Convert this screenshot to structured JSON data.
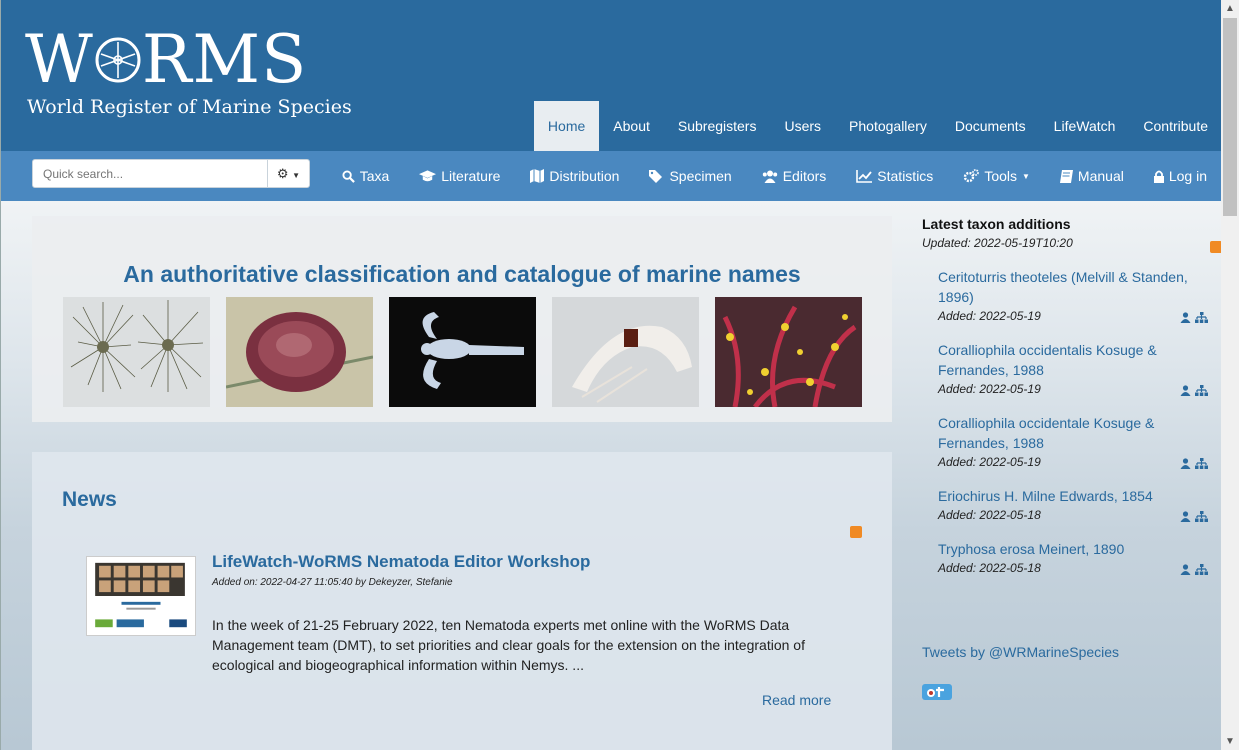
{
  "header": {
    "logo_text": "WoRMS",
    "logo_subtitle": "World Register of Marine Species"
  },
  "main_nav": [
    {
      "label": "Home",
      "active": true
    },
    {
      "label": "About"
    },
    {
      "label": "Subregisters"
    },
    {
      "label": "Users"
    },
    {
      "label": "Photogallery"
    },
    {
      "label": "Documents"
    },
    {
      "label": "LifeWatch"
    },
    {
      "label": "Contribute"
    }
  ],
  "search": {
    "placeholder": "Quick search...",
    "options_icon": "gear-icon"
  },
  "sub_nav": [
    {
      "label": "Taxa",
      "icon": "search-icon"
    },
    {
      "label": "Literature",
      "icon": "graduation-cap-icon"
    },
    {
      "label": "Distribution",
      "icon": "map-icon"
    },
    {
      "label": "Specimen",
      "icon": "tags-icon"
    },
    {
      "label": "Editors",
      "icon": "users-icon"
    },
    {
      "label": "Statistics",
      "icon": "line-chart-icon"
    },
    {
      "label": "Tools",
      "icon": "cogs-icon"
    },
    {
      "label": "Manual",
      "icon": "book-icon"
    },
    {
      "label": "Log in",
      "icon": "lock-icon"
    }
  ],
  "hero": {
    "title": "An authoritative classification and catalogue of marine names"
  },
  "news": {
    "heading": "News",
    "item": {
      "title": "LifeWatch-WoRMS Nematoda Editor Workshop",
      "meta": "Added on: 2022-04-27 11:05:40 by Dekeyzer, Stefanie",
      "body": "In the week of 21-25 February 2022, ten Nematoda experts met online with the WoRMS Data Management team (DMT), to set priorities and clear goals for the extension on the integration of ecological and biogeographical information within Nemys. ...",
      "read_more": "Read more"
    }
  },
  "sidebar": {
    "title": "Latest taxon additions",
    "updated": "Updated: 2022-05-19T10:20",
    "taxa": [
      {
        "name": "Ceritoturris theoteles (Melvill & Standen, 1896)",
        "added": "Added: 2022-05-19"
      },
      {
        "name": "Coralliophila occidentalis Kosuge & Fernandes, 1988",
        "added": "Added: 2022-05-19"
      },
      {
        "name": "Coralliophila occidentale Kosuge & Fernandes, 1988",
        "added": "Added: 2022-05-19"
      },
      {
        "name": "Eriochirus H. Milne Edwards, 1854",
        "added": "Added: 2022-05-18"
      },
      {
        "name": "Tryphosa erosa Meinert, 1890",
        "added": "Added: 2022-05-18"
      }
    ],
    "tweets_link": "Tweets by @WRMarineSpecies"
  },
  "colors": {
    "brand": "#2a6a9e",
    "toolbar": "#4a88c0",
    "rss": "#f08a24"
  }
}
